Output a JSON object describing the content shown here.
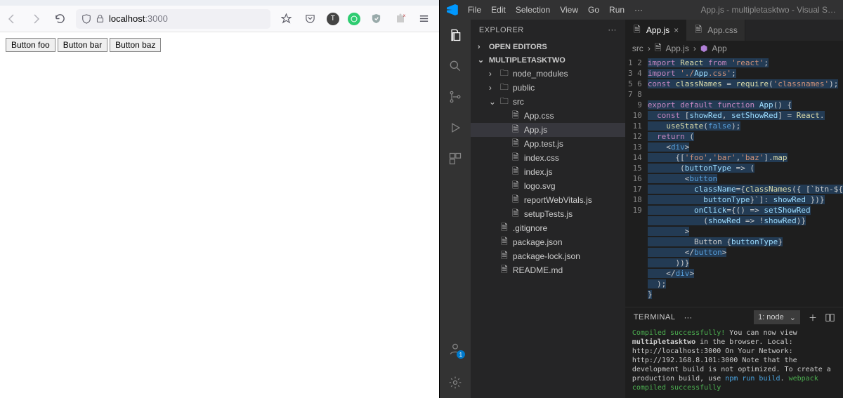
{
  "browser": {
    "url_host": "localhost",
    "url_port": ":3000",
    "buttons": [
      "Button foo",
      "Button bar",
      "Button baz"
    ]
  },
  "vscode": {
    "menu": [
      "File",
      "Edit",
      "Selection",
      "View",
      "Go",
      "Run",
      "···"
    ],
    "window_title": "App.js - multipletasktwo - Visual S…",
    "explorer": {
      "title": "EXPLORER",
      "open_editors": "OPEN EDITORS",
      "project": "MULTIPLETASKTWO",
      "tree": [
        {
          "name": "node_modules",
          "kind": "folder",
          "indent": 1,
          "open": false
        },
        {
          "name": "public",
          "kind": "folder",
          "indent": 1,
          "open": false
        },
        {
          "name": "src",
          "kind": "folder",
          "indent": 1,
          "open": true
        },
        {
          "name": "App.css",
          "kind": "file",
          "indent": 2
        },
        {
          "name": "App.js",
          "kind": "file",
          "indent": 2,
          "selected": true
        },
        {
          "name": "App.test.js",
          "kind": "file",
          "indent": 2
        },
        {
          "name": "index.css",
          "kind": "file",
          "indent": 2
        },
        {
          "name": "index.js",
          "kind": "file",
          "indent": 2
        },
        {
          "name": "logo.svg",
          "kind": "file",
          "indent": 2
        },
        {
          "name": "reportWebVitals.js",
          "kind": "file",
          "indent": 2
        },
        {
          "name": "setupTests.js",
          "kind": "file",
          "indent": 2
        },
        {
          "name": ".gitignore",
          "kind": "file",
          "indent": 1
        },
        {
          "name": "package.json",
          "kind": "file",
          "indent": 1
        },
        {
          "name": "package-lock.json",
          "kind": "file",
          "indent": 1
        },
        {
          "name": "README.md",
          "kind": "file",
          "indent": 1
        }
      ]
    },
    "tabs": [
      {
        "label": "App.js",
        "active": true
      },
      {
        "label": "App.css",
        "active": false
      }
    ],
    "breadcrumbs": [
      "src",
      "App.js",
      "App"
    ],
    "code_lines": [
      "import React from 'react';",
      "import './App.css';",
      "const classNames = require('classnames');",
      "",
      "export default function App() {",
      "  const [showRed, setShowRed] = React.",
      "    useState(false);",
      "  return (",
      "    <div>",
      "      {['foo','bar','baz'].map",
      "       (buttonType => (",
      "        <button",
      "          className={classNames({ [`btn-${",
      "            buttonType}`]: showRed })}",
      "          onClick={() => setShowRed",
      "            (showRed => !showRed)}",
      "        >",
      "          Button {buttonType}",
      "        </button>",
      "      ))}",
      "    </div>",
      "  );",
      "}"
    ],
    "line_numbers": [
      1,
      2,
      3,
      4,
      5,
      6,
      7,
      8,
      9,
      10,
      11,
      12,
      13,
      14,
      15,
      16,
      17,
      18,
      19
    ],
    "terminal": {
      "title": "TERMINAL",
      "shell": "1: node",
      "lines": [
        "Compiled successfully!",
        "",
        "You can now view multipletasktwo in the browser.",
        "",
        "  Local:           http://localhost:3000",
        "  On Your Network: http://192.168.8.101:3000",
        "",
        "Note that the development build is not optimized.",
        "To create a production build, use npm run build.",
        "",
        "webpack compiled successfully"
      ]
    }
  }
}
